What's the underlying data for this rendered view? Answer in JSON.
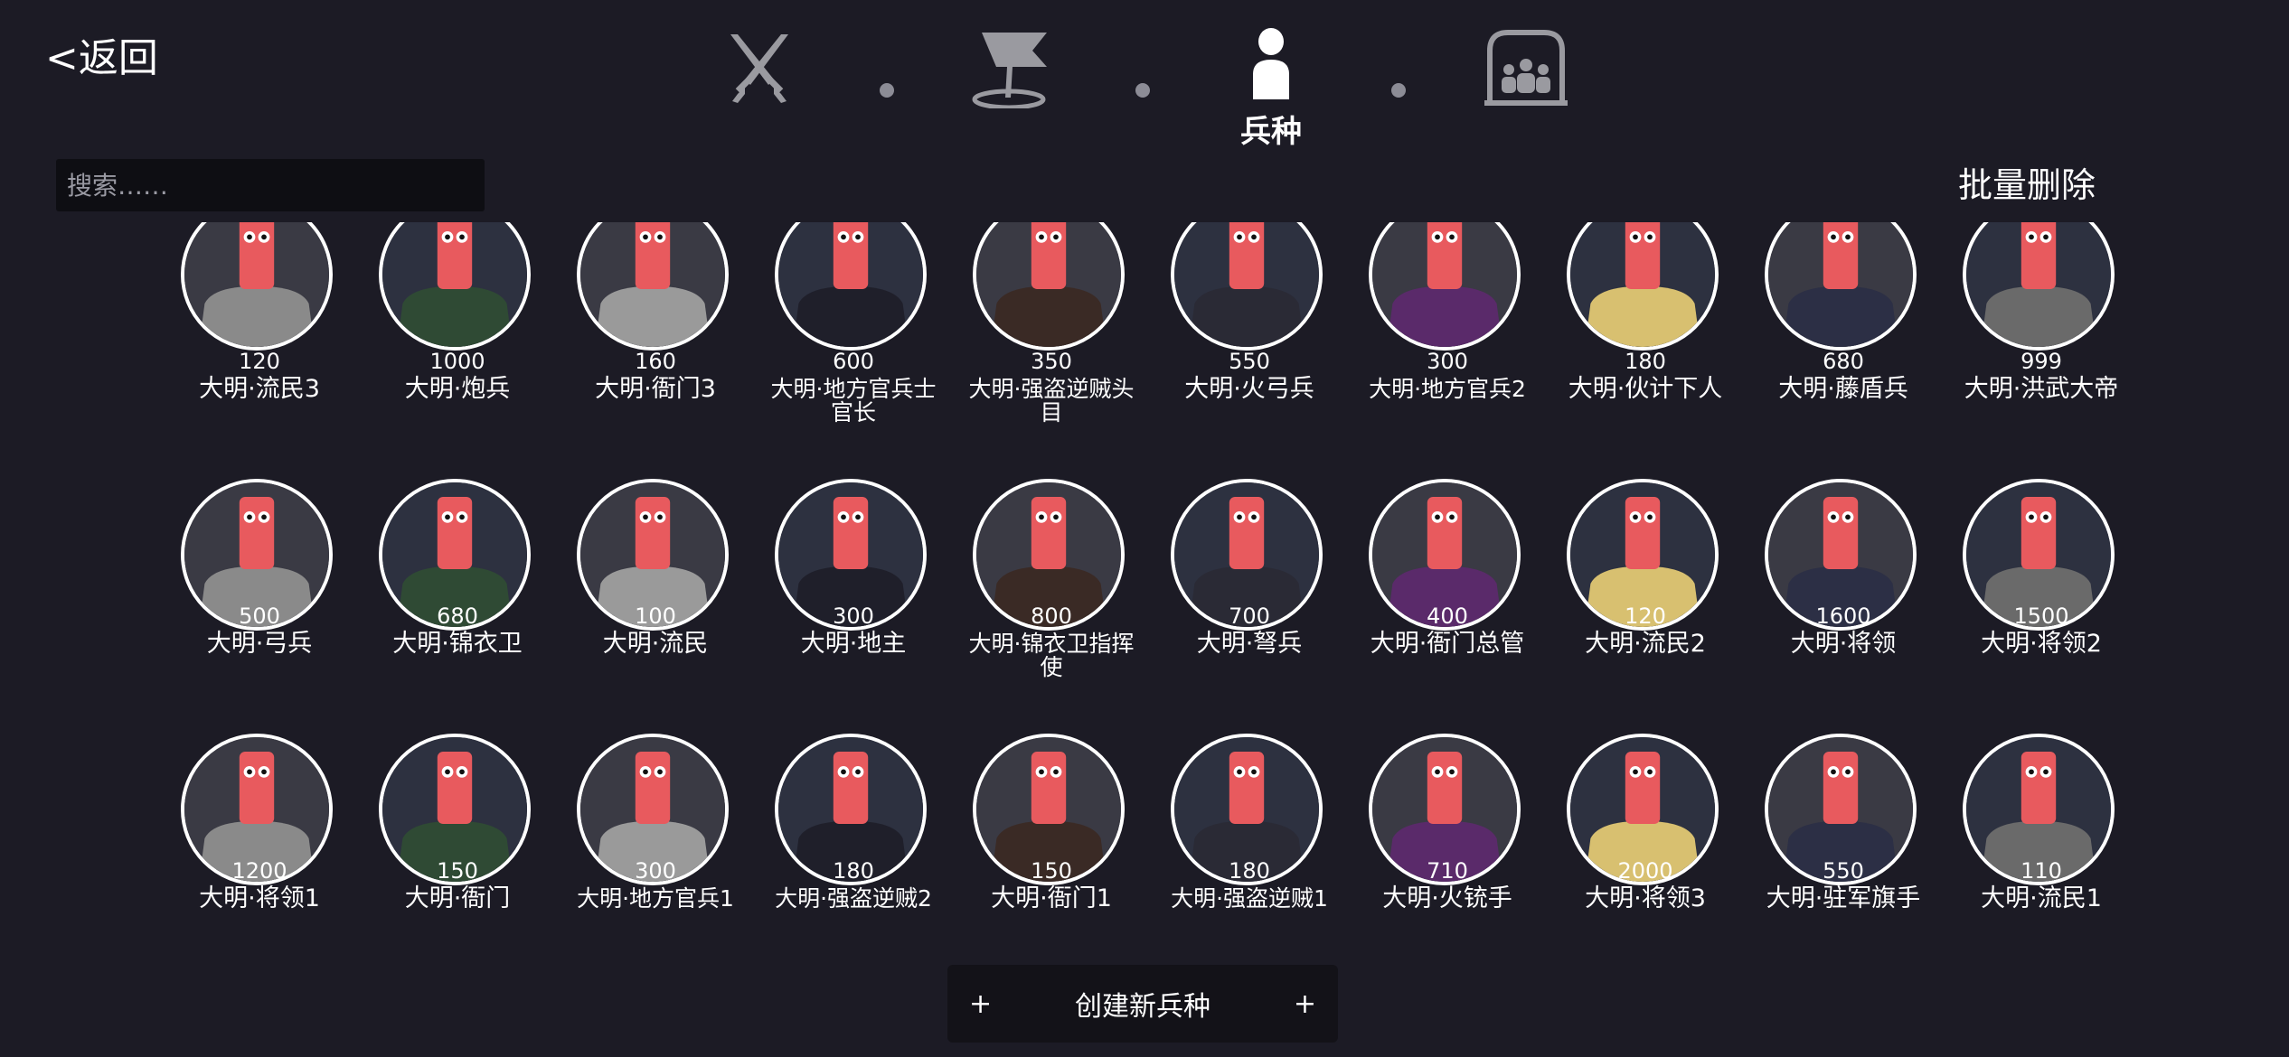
{
  "header": {
    "back_label": "<返回",
    "tabs": [
      {
        "icon": "crossed-swords-icon"
      },
      {
        "icon": "flag-icon"
      },
      {
        "icon": "person-icon",
        "label": "兵种",
        "active": true
      },
      {
        "icon": "group-icon"
      }
    ]
  },
  "search": {
    "placeholder": "搜索……"
  },
  "batch_delete_label": "批量删除",
  "units": [
    {
      "cost": "120",
      "name": "大明·流民3"
    },
    {
      "cost": "1000",
      "name": "大明·炮兵"
    },
    {
      "cost": "160",
      "name": "大明·衙门3"
    },
    {
      "cost": "600",
      "name": "大明·地方官兵士官长"
    },
    {
      "cost": "350",
      "name": "大明·强盗逆贼头目"
    },
    {
      "cost": "550",
      "name": "大明·火弓兵"
    },
    {
      "cost": "300",
      "name": "大明·地方官兵2"
    },
    {
      "cost": "180",
      "name": "大明·伙计下人"
    },
    {
      "cost": "680",
      "name": "大明·藤盾兵"
    },
    {
      "cost": "999",
      "name": "大明·洪武大帝"
    },
    {
      "cost": "500",
      "name": "大明·弓兵"
    },
    {
      "cost": "680",
      "name": "大明·锦衣卫"
    },
    {
      "cost": "100",
      "name": "大明·流民"
    },
    {
      "cost": "300",
      "name": "大明·地主"
    },
    {
      "cost": "800",
      "name": "大明·锦衣卫指挥使"
    },
    {
      "cost": "700",
      "name": "大明·弩兵"
    },
    {
      "cost": "400",
      "name": "大明·衙门总管"
    },
    {
      "cost": "120",
      "name": "大明·流民2"
    },
    {
      "cost": "1600",
      "name": "大明·将领"
    },
    {
      "cost": "1500",
      "name": "大明·将领2"
    },
    {
      "cost": "1200",
      "name": "大明·将领1"
    },
    {
      "cost": "150",
      "name": "大明·衙门"
    },
    {
      "cost": "300",
      "name": "大明·地方官兵1"
    },
    {
      "cost": "180",
      "name": "大明·强盗逆贼2"
    },
    {
      "cost": "150",
      "name": "大明·衙门1"
    },
    {
      "cost": "180",
      "name": "大明·强盗逆贼1"
    },
    {
      "cost": "710",
      "name": "大明·火铳手"
    },
    {
      "cost": "2000",
      "name": "大明·将领3"
    },
    {
      "cost": "550",
      "name": "大明·驻军旗手"
    },
    {
      "cost": "110",
      "name": "大明·流民1"
    }
  ],
  "create_button": {
    "label": "创建新兵种",
    "plus": "+"
  },
  "colors": {
    "background": "#1c1b25",
    "unit_skin": "#e85a5e",
    "portrait_border": "#ffffff"
  }
}
